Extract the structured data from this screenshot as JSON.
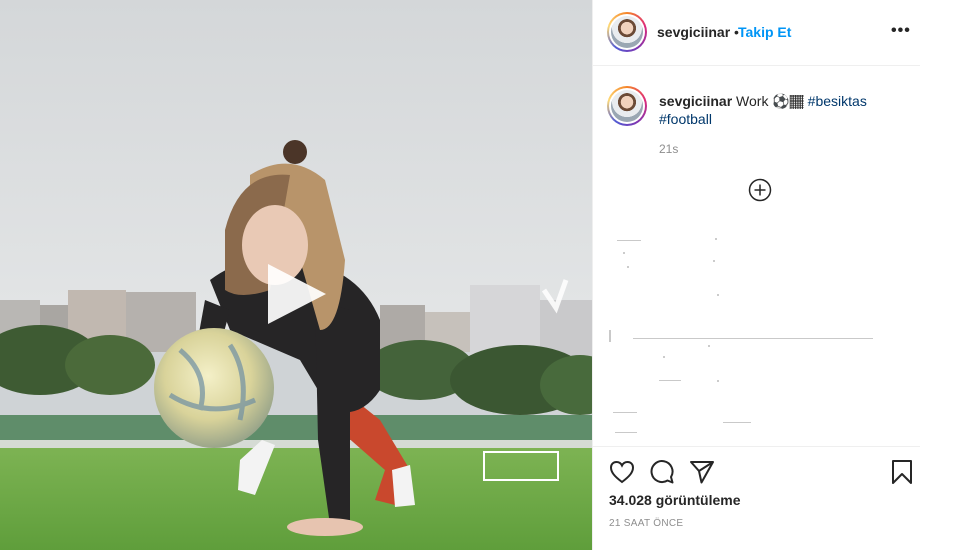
{
  "post": {
    "username": "sevgiciinar",
    "separator": "•",
    "follow_label": "Takip Et",
    "more_label": "•••",
    "caption": {
      "username": "sevgiciinar",
      "text": "Work ⚽️🏾",
      "tag1": "#besiktas",
      "tag2": "#football"
    },
    "time_ago": "21s",
    "views": "34.028 görüntüleme",
    "posted": "21 SAAT ÖNCE"
  },
  "icons": {
    "avatar": "profile-avatar",
    "play": "play-icon",
    "load_more": "plus-circle-icon",
    "like": "heart-icon",
    "comment": "comment-bubble-icon",
    "share": "paper-plane-icon",
    "save": "bookmark-icon",
    "more": "ellipsis-icon"
  }
}
